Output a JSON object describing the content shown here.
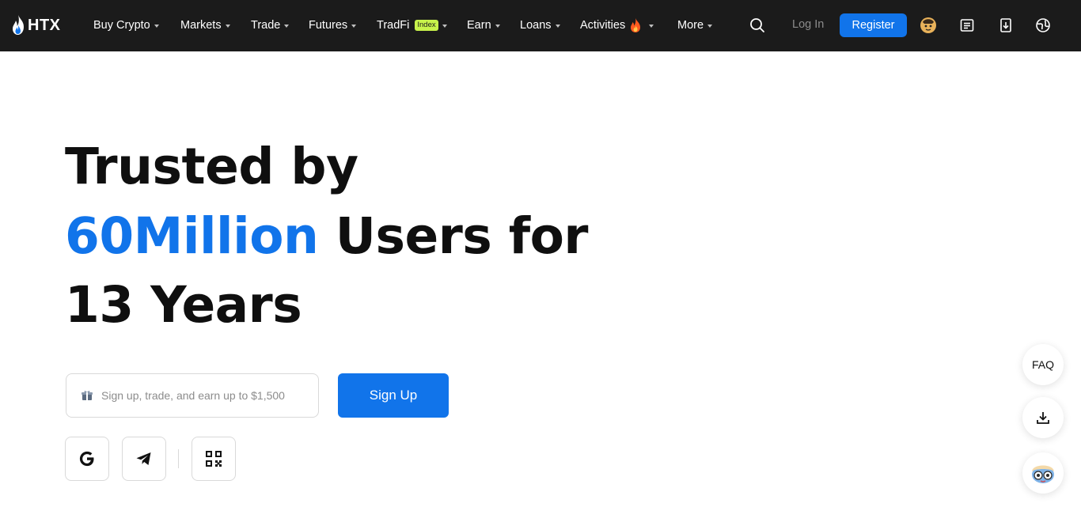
{
  "brand": {
    "name": "HTX"
  },
  "nav": {
    "items": [
      {
        "label": "Buy Crypto"
      },
      {
        "label": "Markets"
      },
      {
        "label": "Trade"
      },
      {
        "label": "Futures"
      },
      {
        "label": "TradFi",
        "badge": "Index"
      },
      {
        "label": "Earn"
      },
      {
        "label": "Loans"
      },
      {
        "label": "Activities"
      },
      {
        "label": "More"
      }
    ],
    "login_label": "Log In",
    "register_label": "Register",
    "icons": [
      "search-icon",
      "avatar-icon",
      "orders-icon",
      "download-icon",
      "globe-icon"
    ]
  },
  "hero": {
    "line1": "Trusted by",
    "line2_highlight": "60Million",
    "line2_rest": " Users for",
    "line3": "13 Years"
  },
  "signup": {
    "placeholder": "Sign up, trade, and earn up to $1,500",
    "button_label": "Sign Up"
  },
  "social": [
    "google-icon",
    "telegram-icon",
    "qr-code-icon"
  ],
  "floating": {
    "faq_label": "FAQ",
    "icons": [
      "download-icon",
      "support-avatar-icon"
    ]
  },
  "colors": {
    "accent": "#1174ea",
    "nav_bg": "#1b1b1b",
    "badge_bg": "#c8f34b",
    "activities_fire": "#ff5a1f"
  }
}
